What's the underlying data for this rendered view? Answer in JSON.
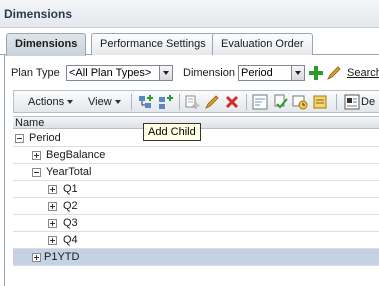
{
  "window": {
    "title": "Dimensions"
  },
  "tabs": [
    {
      "label": "Dimensions",
      "underline": "i",
      "active": true
    },
    {
      "label": "Performance Settings",
      "underline": "P",
      "active": false
    },
    {
      "label": "Evaluation Order",
      "underline": "O",
      "active": false
    }
  ],
  "filter": {
    "plan_type_label": "Plan Type",
    "plan_type_value": "<All Plan Types>",
    "dimension_label": "Dimension",
    "dimension_value": "Period",
    "search_label": "Search"
  },
  "toolbar": {
    "actions_label": "Actions",
    "view_label": "View",
    "trailing_label": "De"
  },
  "tooltip": {
    "text": "Add Child"
  },
  "grid": {
    "header": "Name",
    "rows": [
      {
        "label": "Period",
        "toggle": "-",
        "level": 0,
        "selected": false
      },
      {
        "label": "BegBalance",
        "toggle": "+",
        "level": 1,
        "selected": false
      },
      {
        "label": "YearTotal",
        "toggle": "-",
        "level": 1,
        "selected": false
      },
      {
        "label": "Q1",
        "toggle": "+",
        "level": 2,
        "selected": false
      },
      {
        "label": "Q2",
        "toggle": "+",
        "level": 2,
        "selected": false
      },
      {
        "label": "Q3",
        "toggle": "+",
        "level": 2,
        "selected": false
      },
      {
        "label": "Q4",
        "toggle": "+",
        "level": 2,
        "selected": false
      },
      {
        "label": "P1YTD",
        "toggle": "+",
        "level": 1,
        "selected": true
      }
    ]
  },
  "colors": {
    "selected_row": "#c5d2e6",
    "add_icon": "#2a9d2a",
    "delete_icon": "#d22b2b",
    "edit_icon": "#d08a1a"
  }
}
